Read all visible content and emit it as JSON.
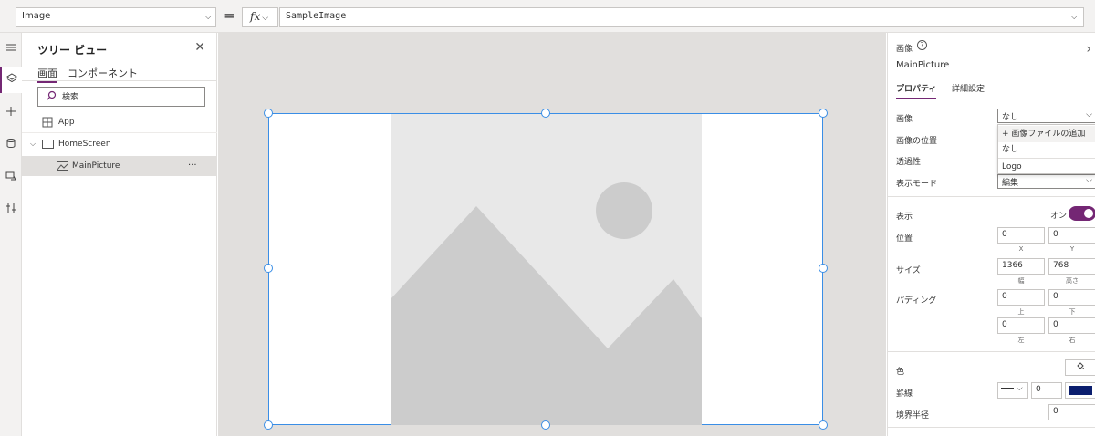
{
  "formula_bar": {
    "property": "Image",
    "equals": "=",
    "fx_label": "fx",
    "formula": "SampleImage"
  },
  "rail": {
    "icons": [
      "hamburger-icon",
      "layers-icon",
      "plus-icon",
      "database-icon",
      "media-icon",
      "tools-icon"
    ]
  },
  "tree": {
    "title": "ツリー ビュー",
    "tabs": [
      "画面",
      "コンポーネント"
    ],
    "search_placeholder": "検索",
    "items": [
      {
        "label": "App"
      },
      {
        "label": "HomeScreen"
      },
      {
        "label": "MainPicture",
        "more": "···"
      }
    ]
  },
  "props": {
    "type_label": "画像",
    "help": "?",
    "control_name": "MainPicture",
    "tabs": [
      "プロパティ",
      "詳細設定"
    ],
    "image_label": "画像",
    "image_value": "なし",
    "image_position_label": "画像の位置",
    "transparency_label": "透過性",
    "display_mode_label": "表示モード",
    "display_mode_value": "編集",
    "dropdown": [
      "+ 画像ファイルの追加",
      "なし",
      "Logo"
    ],
    "visible_label": "表示",
    "visible_state": "オン",
    "position_label": "位置",
    "x": "0",
    "y": "0",
    "x_sub": "X",
    "y_sub": "Y",
    "size_label": "サイズ",
    "width": "1366",
    "height": "768",
    "width_sub": "幅",
    "height_sub": "高さ",
    "padding_label": "パディング",
    "pad_top": "0",
    "pad_bottom": "0",
    "pad_left": "0",
    "pad_right": "0",
    "pad_top_sub": "上",
    "pad_bottom_sub": "下",
    "pad_left_sub": "左",
    "pad_right_sub": "右",
    "color_label": "色",
    "border_label": "罫線",
    "border_width": "0",
    "border_color": "#0b1e6e",
    "radius_label": "境界半径",
    "radius_value": "0"
  },
  "colors": {
    "accent": "#742774",
    "selection": "#3a8ee6"
  }
}
